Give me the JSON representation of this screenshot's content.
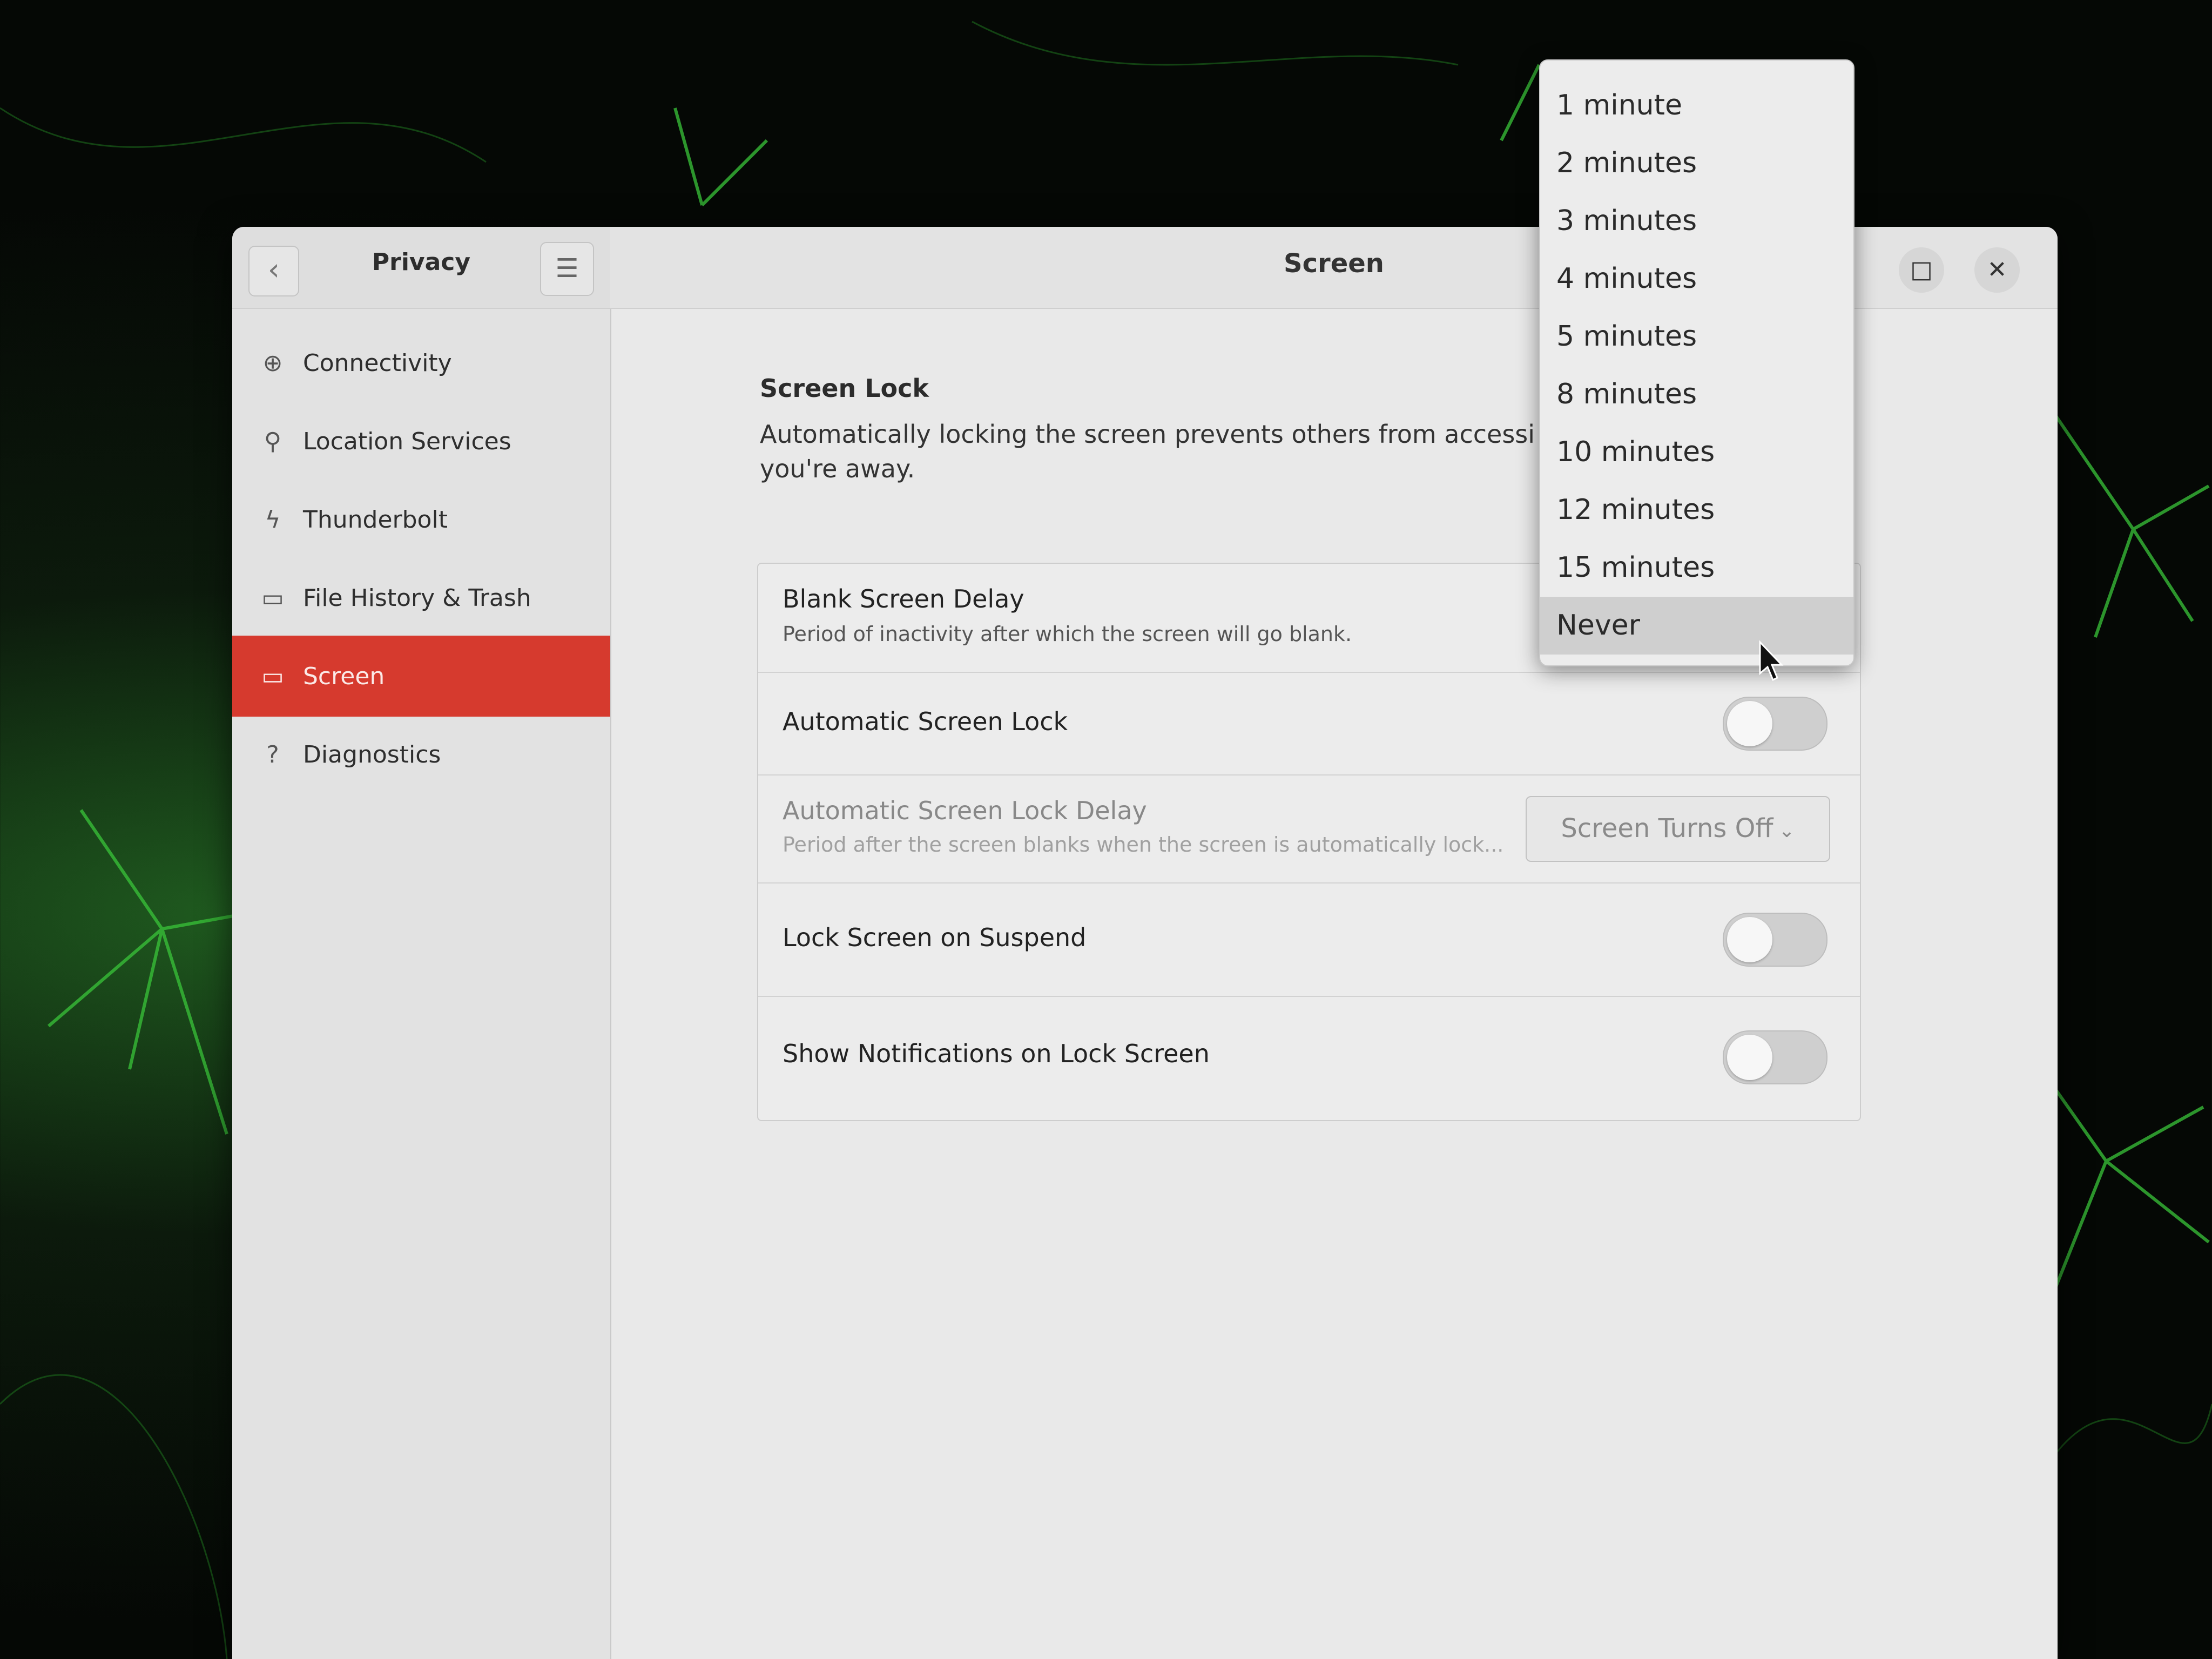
{
  "sidebar": {
    "title": "Privacy",
    "back_icon": "‹",
    "menu_icon": "☰",
    "items": [
      {
        "label": "Connectivity",
        "icon": "globe-icon",
        "glyph": "⊕"
      },
      {
        "label": "Location Services",
        "icon": "location-pin-icon",
        "glyph": "⚲"
      },
      {
        "label": "Thunderbolt",
        "icon": "thunderbolt-icon",
        "glyph": "ϟ"
      },
      {
        "label": "File History & Trash",
        "icon": "folder-icon",
        "glyph": "▭"
      },
      {
        "label": "Screen",
        "icon": "display-icon",
        "glyph": "▭",
        "active": true
      },
      {
        "label": "Diagnostics",
        "icon": "help-icon",
        "glyph": "?"
      }
    ]
  },
  "header": {
    "title": "Screen",
    "maximize_glyph": "□",
    "close_glyph": "✕"
  },
  "screen_lock": {
    "title": "Screen Lock",
    "description": "Automatically locking the screen prevents others from accessi",
    "description_line2": "you're away.",
    "rows": {
      "blank_screen_delay": {
        "label": "Blank Screen Delay",
        "sub": "Period of inactivity after which the screen will go blank."
      },
      "automatic_screen_lock": {
        "label": "Automatic Screen Lock",
        "enabled": false
      },
      "automatic_screen_lock_delay": {
        "label": "Automatic Screen Lock Delay",
        "sub": "Period after the screen blanks when the screen is automatically lock...",
        "value": "Screen Turns Off",
        "chevron": "⌄"
      },
      "lock_screen_on_suspend": {
        "label": "Lock Screen on Suspend",
        "enabled": false
      },
      "show_notifications": {
        "label": "Show Notifications on Lock Screen",
        "enabled": false
      }
    }
  },
  "blank_delay_dropdown": {
    "options": [
      "1 minute",
      "2 minutes",
      "3 minutes",
      "4 minutes",
      "5 minutes",
      "8 minutes",
      "10 minutes",
      "12 minutes",
      "15 minutes",
      "Never"
    ],
    "highlighted": "Never"
  },
  "colors": {
    "accent": "#d63a2e",
    "background_green": "#2b7a2b"
  }
}
